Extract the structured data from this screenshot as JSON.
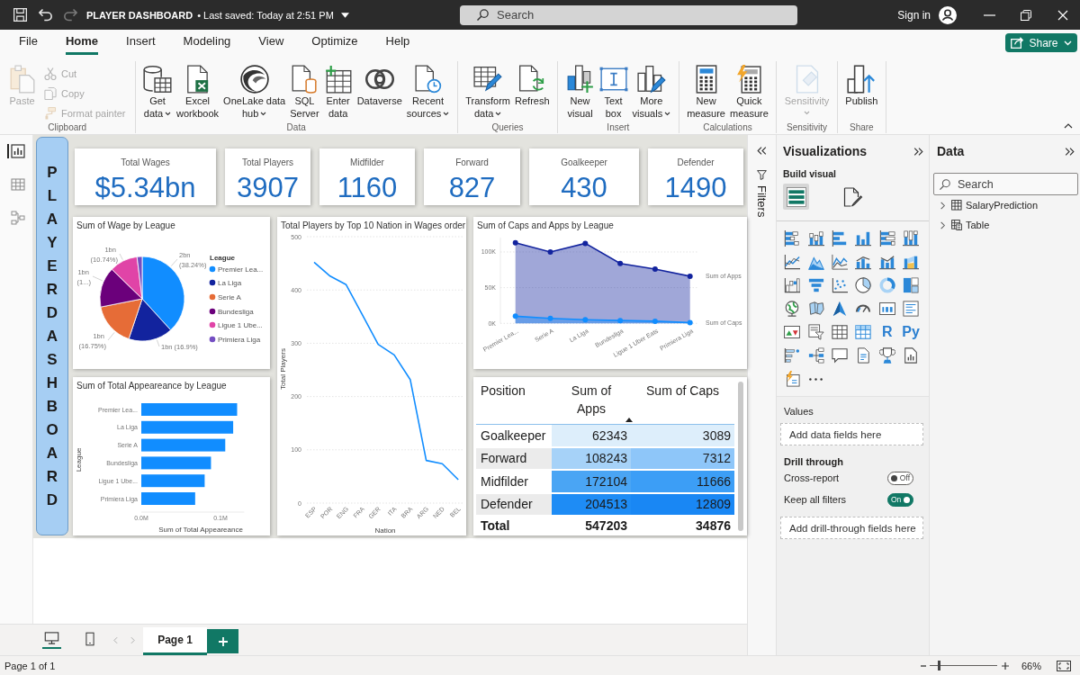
{
  "title_bar": {
    "title": "PLAYER DASHBOARD",
    "saved": "• Last saved: Today at 2:51 PM",
    "search_placeholder": "Search",
    "sign_in": "Sign in"
  },
  "menu_tabs": [
    {
      "label": "File",
      "selected": false
    },
    {
      "label": "Home",
      "selected": true
    },
    {
      "label": "Insert",
      "selected": false
    },
    {
      "label": "Modeling",
      "selected": false
    },
    {
      "label": "View",
      "selected": false
    },
    {
      "label": "Optimize",
      "selected": false
    },
    {
      "label": "Help",
      "selected": false
    }
  ],
  "share_button": {
    "label": "Share"
  },
  "ribbon": [
    {
      "group": "Clipboard",
      "items": [
        {
          "kind": "large",
          "label_lines": [
            "Paste"
          ],
          "dropdown": false,
          "disabled": true
        },
        {
          "kind": "small",
          "label_lines": [
            "Cut"
          ],
          "dropdown": false,
          "disabled": true
        },
        {
          "kind": "small",
          "label_lines": [
            "Copy"
          ],
          "dropdown": false,
          "disabled": true
        },
        {
          "kind": "small",
          "label_lines": [
            "Format painter"
          ],
          "dropdown": false,
          "disabled": true
        }
      ]
    },
    {
      "group": "Data",
      "items": [
        {
          "kind": "large",
          "label_lines": [
            "Get",
            "data"
          ],
          "dropdown": true,
          "disabled": false
        },
        {
          "kind": "large",
          "label_lines": [
            "Excel",
            "workbook"
          ],
          "dropdown": false,
          "disabled": false
        },
        {
          "kind": "large",
          "label_lines": [
            "OneLake data",
            "hub"
          ],
          "dropdown": true,
          "disabled": false
        },
        {
          "kind": "large",
          "label_lines": [
            "SQL",
            "Server"
          ],
          "dropdown": false,
          "disabled": false
        },
        {
          "kind": "large",
          "label_lines": [
            "Enter",
            "data"
          ],
          "dropdown": false,
          "disabled": false
        },
        {
          "kind": "large",
          "label_lines": [
            "Dataverse"
          ],
          "dropdown": false,
          "disabled": false
        },
        {
          "kind": "large",
          "label_lines": [
            "Recent",
            "sources"
          ],
          "dropdown": true,
          "disabled": false
        }
      ]
    },
    {
      "group": "Queries",
      "items": [
        {
          "kind": "large",
          "label_lines": [
            "Transform",
            "data"
          ],
          "dropdown": true,
          "disabled": false
        },
        {
          "kind": "large",
          "label_lines": [
            "Refresh"
          ],
          "dropdown": false,
          "disabled": false
        }
      ]
    },
    {
      "group": "Insert",
      "items": [
        {
          "kind": "large",
          "label_lines": [
            "New",
            "visual"
          ],
          "dropdown": false,
          "disabled": false
        },
        {
          "kind": "large",
          "label_lines": [
            "Text",
            "box"
          ],
          "dropdown": false,
          "disabled": false
        },
        {
          "kind": "large",
          "label_lines": [
            "More",
            "visuals"
          ],
          "dropdown": true,
          "disabled": false
        }
      ]
    },
    {
      "group": "Calculations",
      "items": [
        {
          "kind": "large",
          "label_lines": [
            "New",
            "measure"
          ],
          "dropdown": false,
          "disabled": false
        },
        {
          "kind": "large",
          "label_lines": [
            "Quick",
            "measure"
          ],
          "dropdown": false,
          "disabled": false
        }
      ]
    },
    {
      "group": "Sensitivity",
      "items": [
        {
          "kind": "large",
          "label_lines": [
            "Sensitivity"
          ],
          "dropdown": true,
          "disabled": true
        }
      ]
    },
    {
      "group": "Share",
      "items": [
        {
          "kind": "large",
          "label_lines": [
            "Publish"
          ],
          "dropdown": false,
          "disabled": false
        }
      ]
    }
  ],
  "view_rail": [
    {
      "selected": true
    },
    {
      "selected": false
    },
    {
      "selected": false
    }
  ],
  "report": {
    "banner": "PLAYER DASHBOARD",
    "kpi_cards": [
      {
        "label": "Total Wages",
        "value": "$5.34bn"
      },
      {
        "label": "Total Players",
        "value": "3907"
      },
      {
        "label": "Midfilder",
        "value": "1160"
      },
      {
        "label": "Forward",
        "value": "827"
      },
      {
        "label": "Goalkeeper",
        "value": "430"
      },
      {
        "label": "Defender",
        "value": "1490"
      }
    ],
    "wage_pie": {
      "chart_data": {
        "type": "pie",
        "title": "Sum of Wage by League",
        "legend_title": "League",
        "legend": "right",
        "categories": [
          "Premier Lea...",
          "La Liga",
          "Serie A",
          "Bundesliga",
          "Ligue 1 Ube...",
          "Primiera Liga"
        ],
        "values": [
          38.24,
          16.9,
          16.75,
          15.4,
          10.74,
          1.97
        ],
        "colors": [
          "#118dff",
          "#12239e",
          "#e66c37",
          "#6b007b",
          "#e044a7",
          "#744ec2"
        ]
      },
      "slice_labels": [
        "1bn (10.74%)",
        "2bn (38.24%)",
        "1bn (1...)",
        "1bn (16.75%)",
        "1bn (16.9%)"
      ]
    },
    "players_by_nation": {
      "chart_data": {
        "type": "line",
        "title": "Total Players by Top 10 Nation in Wages order",
        "xlabel": "Nation",
        "ylabel": "Total Players",
        "categories": [
          "ESP",
          "POR",
          "ENG",
          "FRA",
          "GER",
          "ITA",
          "BRA",
          "ARG",
          "NED",
          "BEL"
        ],
        "values": [
          452,
          426,
          410,
          354,
          298,
          278,
          232,
          80,
          74,
          44
        ],
        "color": "#118dff",
        "yticks": [
          0,
          100,
          200,
          300,
          400,
          500
        ],
        "ylim": [
          0,
          500
        ],
        "grid": true
      }
    },
    "caps_apps_area": {
      "chart_data": {
        "type": "area",
        "title": "Sum of Caps and Apps by League",
        "categories": [
          "Premier Lea...",
          "Serie A",
          "La Liga",
          "Bundesliga",
          "Ligue 1 Uber Eats",
          "Primiera Liga"
        ],
        "yticks": [
          {
            "value": 0,
            "label": "0K"
          },
          {
            "value": 50000,
            "label": "50K"
          },
          {
            "value": 100000,
            "label": "100K"
          }
        ],
        "ylim": [
          0,
          120000
        ],
        "series": [
          {
            "name": "Sum of Apps",
            "color": "#12239e",
            "values": [
              113000,
              100000,
              112000,
              84000,
              76000,
              66000
            ]
          },
          {
            "name": "Sum of Caps",
            "color": "#118dff",
            "values": [
              10000,
              7000,
              5000,
              4000,
              3000,
              1000
            ]
          }
        ],
        "marker": "circle",
        "legend": "right",
        "grid": true
      }
    },
    "appearance_bars": {
      "chart_data": {
        "type": "bar",
        "orientation": "horizontal",
        "title": "Sum of Total Appeareance by League",
        "xlabel": "Sum of Total Appeareance",
        "ylabel": "League",
        "categories": [
          "Premier Lea...",
          "La Liga",
          "Serie A",
          "Bundesliga",
          "Ligue 1 Ube...",
          "Primiera Liga"
        ],
        "values": [
          0.121,
          0.116,
          0.106,
          0.088,
          0.08,
          0.068
        ],
        "color": "#118dff",
        "xticks": [
          {
            "value": 0,
            "label": "0.0M"
          },
          {
            "value": 0.1,
            "label": "0.1M"
          }
        ],
        "xlim": [
          0,
          0.13
        ]
      }
    },
    "position_table": {
      "columns": [
        {
          "label": "Position",
          "sorted": false
        },
        {
          "label": "Sum of Apps",
          "sorted": true
        },
        {
          "label": "Sum of Caps",
          "sorted": false
        }
      ],
      "rows": [
        {
          "cells": [
            {
              "text": "Goalkeeper"
            },
            {
              "text": "62343",
              "color": "#ddeefb"
            },
            {
              "text": "3089",
              "color": "#ddeefb"
            }
          ]
        },
        {
          "cells": [
            {
              "text": "Forward"
            },
            {
              "text": "108243",
              "color": "#a6d2f8"
            },
            {
              "text": "7312",
              "color": "#8ec6f9"
            }
          ]
        },
        {
          "cells": [
            {
              "text": "Midfilder"
            },
            {
              "text": "172104",
              "color": "#4aa5f4"
            },
            {
              "text": "11666",
              "color": "#3c9ef6"
            }
          ]
        },
        {
          "cells": [
            {
              "text": "Defender"
            },
            {
              "text": "204513",
              "color": "#1e8cf5"
            },
            {
              "text": "12809",
              "color": "#1987f4"
            }
          ]
        }
      ],
      "total": [
        "Total",
        "547203",
        "34876"
      ]
    }
  },
  "filters_pane": {
    "label": "Filters"
  },
  "visualizations_pane": {
    "title": "Visualizations",
    "subtitle": "Build visual",
    "modes": [
      {
        "selected": true
      },
      {
        "selected": false
      }
    ],
    "script_visuals": [
      "R",
      "Py"
    ],
    "values_well": {
      "label": "Values",
      "placeholder": "Add data fields here"
    },
    "drill_through": {
      "label": "Drill through",
      "toggles": [
        {
          "label": "Cross-report",
          "on": false,
          "state_text": "Off"
        },
        {
          "label": "Keep all filters",
          "on": true,
          "state_text": "On"
        }
      ],
      "placeholder": "Add drill-through fields here"
    }
  },
  "data_pane": {
    "title": "Data",
    "search_placeholder": "Search",
    "tables": [
      {
        "name": "SalaryPrediction",
        "kind": "table",
        "expanded": false
      },
      {
        "name": "Table",
        "kind": "calculated",
        "expanded": false
      }
    ]
  },
  "page_bar": {
    "views": [
      {
        "selected": true
      },
      {
        "selected": false
      }
    ],
    "pages": [
      {
        "label": "Page 1",
        "selected": true
      }
    ]
  },
  "status_bar": {
    "page_info": "Page 1 of 1",
    "zoom": {
      "level": 0.14,
      "reading": "66%"
    }
  }
}
